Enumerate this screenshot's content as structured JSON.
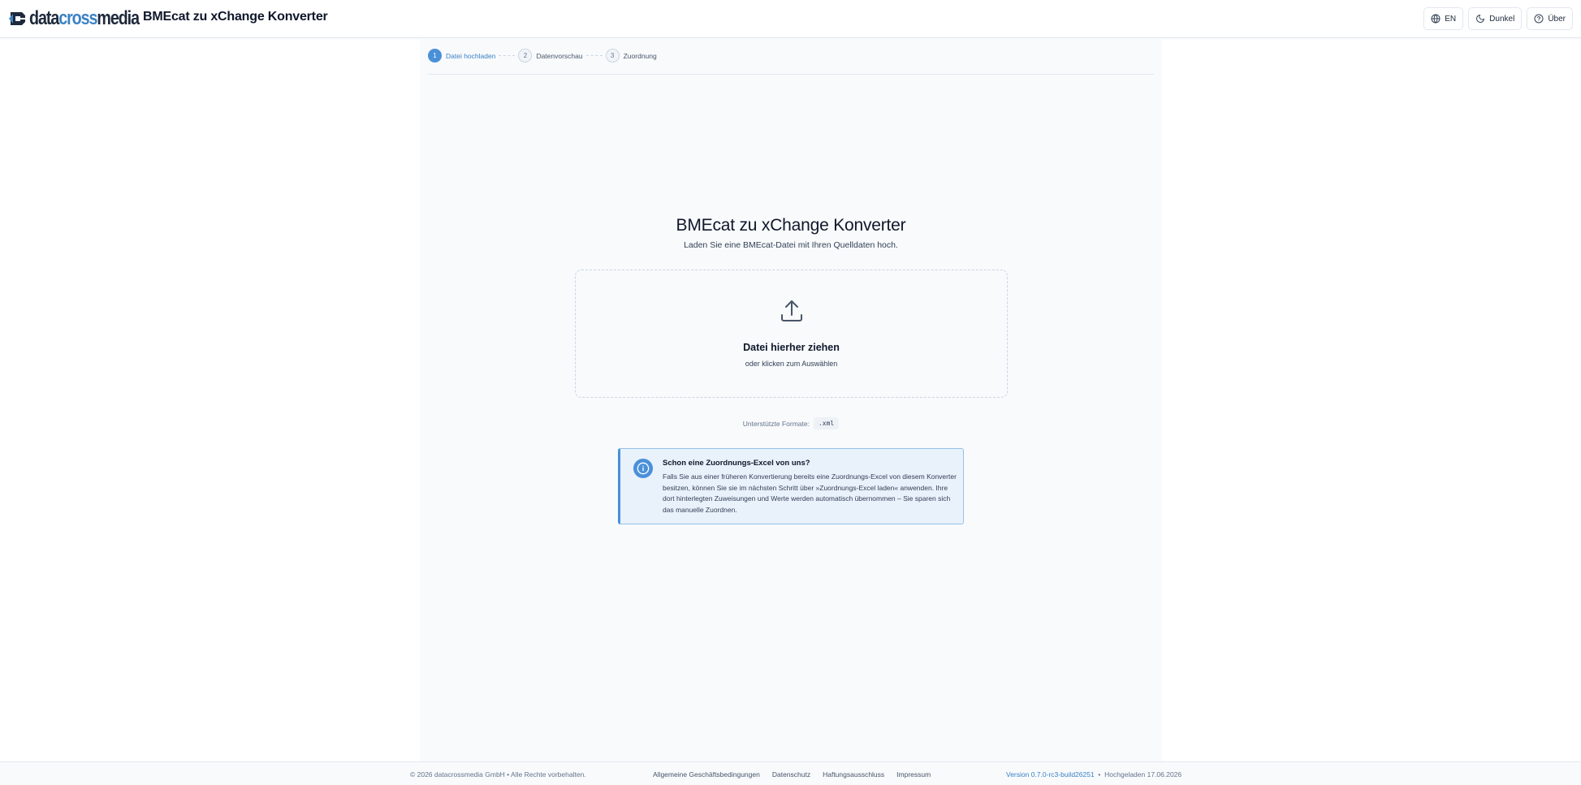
{
  "header": {
    "logo": {
      "part1": "data",
      "part2": "cross",
      "part3": "media",
      "icon": "logo-c-icon"
    },
    "title": "BMEcat zu xChange Konverter",
    "actions": [
      {
        "label": "EN",
        "icon": "globe-icon"
      },
      {
        "label": "Dunkel",
        "icon": "moon-icon"
      },
      {
        "label": "Über",
        "icon": "help-circle-icon"
      }
    ]
  },
  "stepper": {
    "steps": [
      {
        "num": "1",
        "label": "Datei hochladen",
        "active": true
      },
      {
        "num": "2",
        "label": "Datenvorschau",
        "active": false
      },
      {
        "num": "3",
        "label": "Zuordnung",
        "active": false
      }
    ]
  },
  "hero": {
    "title": "BMEcat zu xChange Konverter",
    "subtitle": "Laden Sie eine BMEcat-Datei mit Ihren Quelldaten hoch."
  },
  "dropzone": {
    "icon": "upload-icon",
    "title": "Datei hierher ziehen",
    "subtitle": "oder klicken zum Auswählen"
  },
  "formats": {
    "label": "Unterstützte Formate:",
    "value": ".xml"
  },
  "info": {
    "icon": "info-icon",
    "title": "Schon eine Zuordnungs-Excel von uns?",
    "text": "Falls Sie aus einer früheren Konvertierung bereits eine Zuordnungs-Excel von diesem Konverter besitzen, können Sie sie im nächsten Schritt über »Zuordnungs-Excel laden« anwenden. Ihre dort hinterlegten Zuweisungen und Werte werden automatisch übernommen – Sie sparen sich das manuelle Zuordnen."
  },
  "footer": {
    "copyright": "© 2026 datacrossmedia GmbH • Alle Rechte vorbehalten.",
    "links": [
      "Allgemeine Geschäftsbedingungen",
      "Datenschutz",
      "Haftungsausschluss",
      "Impressum"
    ],
    "version": "Version 0.7.0-rc3-build26251",
    "separator": "•",
    "uploaded": "Hochgeladen 17.06.2026"
  },
  "colors": {
    "accent": "#4a90d9",
    "brand_blue": "#3b82c4",
    "info_bg": "#e9f1fb"
  }
}
